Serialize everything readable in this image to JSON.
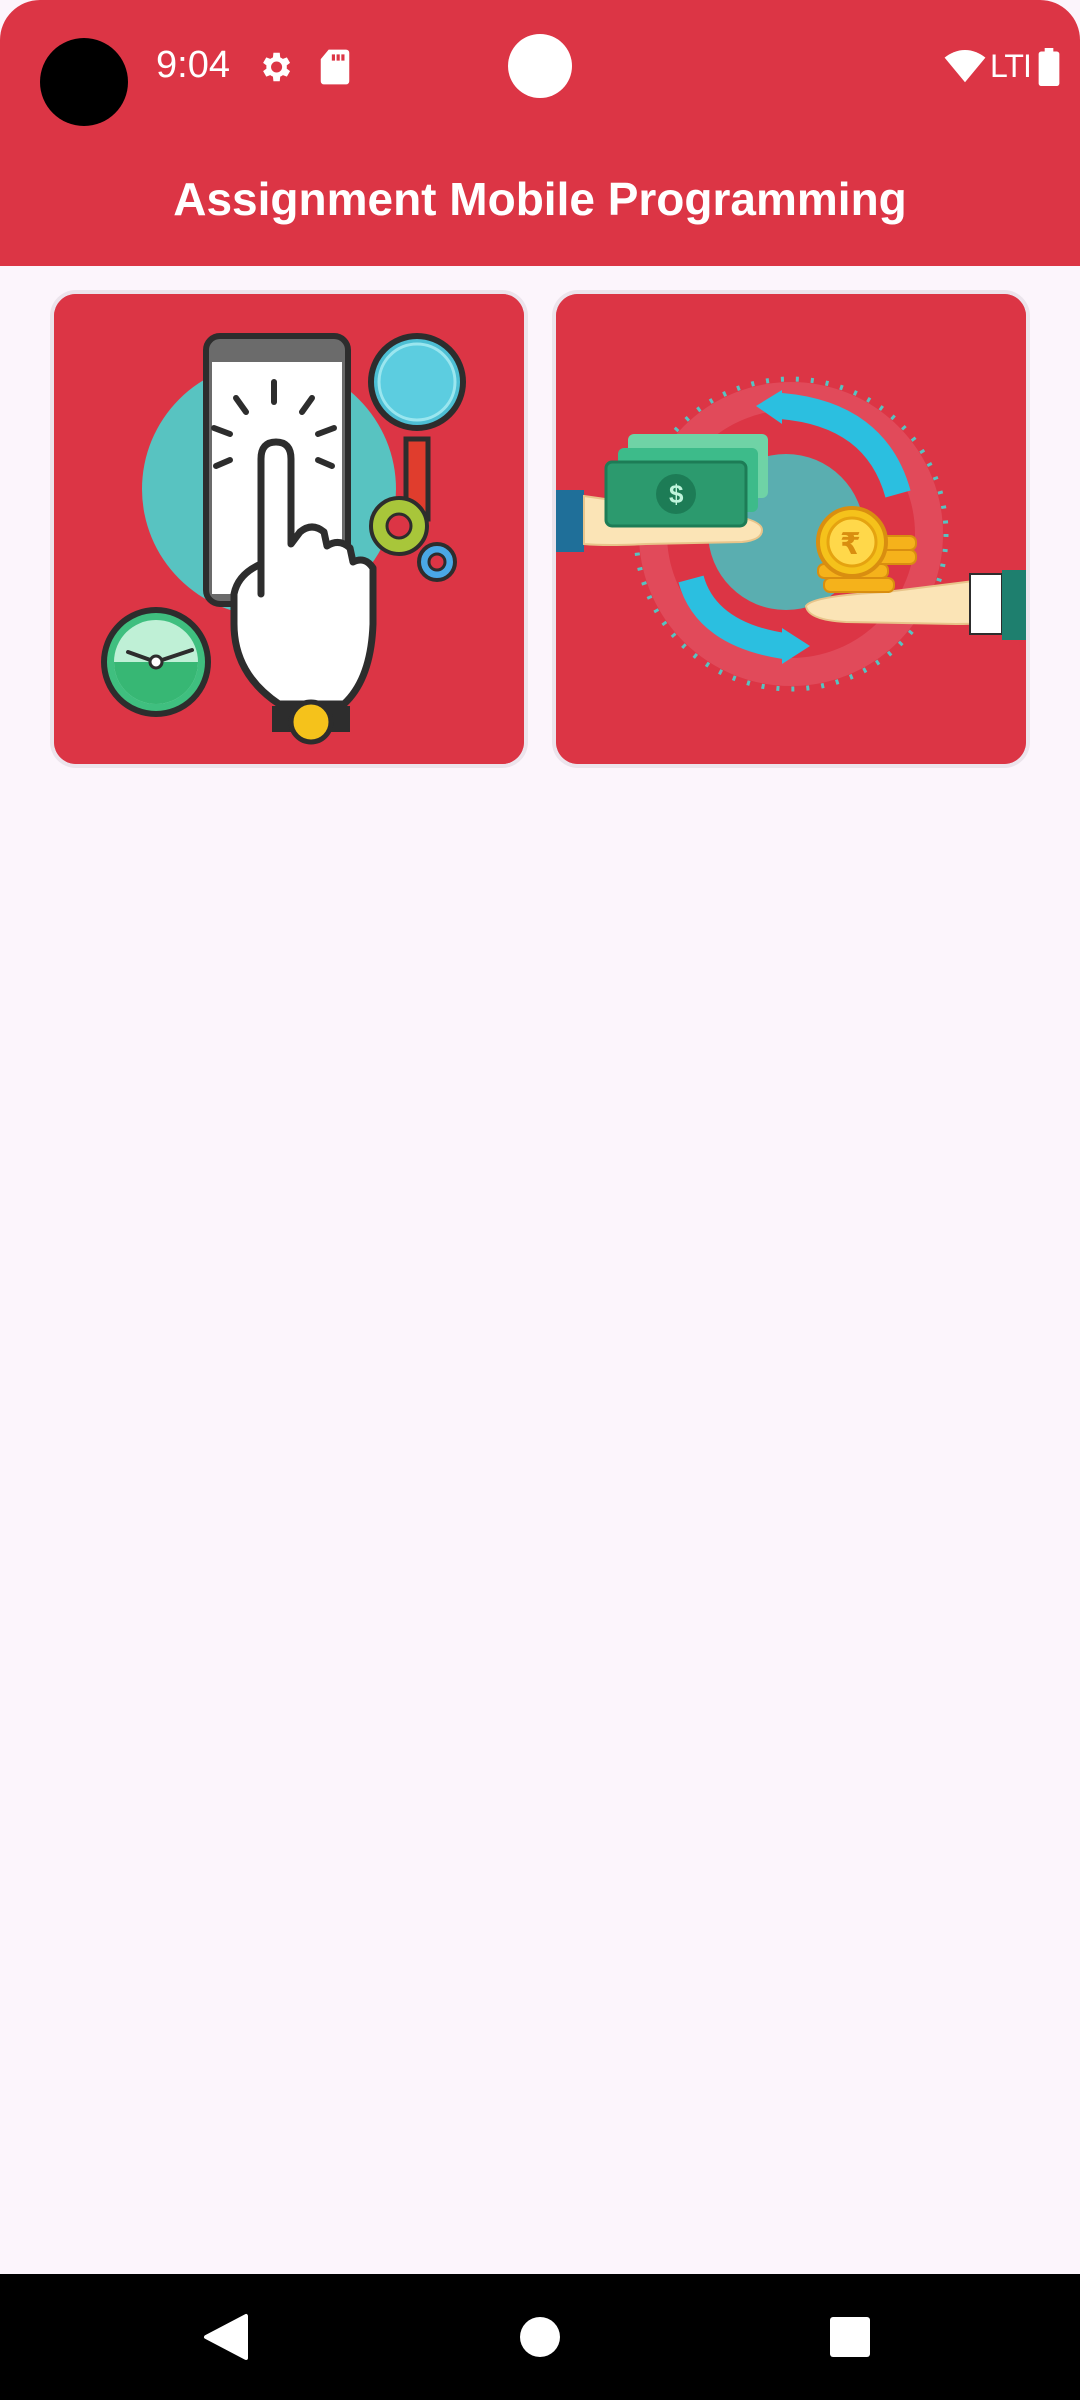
{
  "status_bar": {
    "time": "9:04",
    "network": "LTI",
    "icons": [
      "settings-icon",
      "sd-card-icon",
      "wifi-icon",
      "battery-icon"
    ]
  },
  "app_bar": {
    "title": "Assignment Mobile Programming",
    "color": "#dc3545"
  },
  "menu_cards": [
    {
      "id": "touch-tap",
      "image": "hand-tapping-smartphone-illustration"
    },
    {
      "id": "money-exchange",
      "image": "money-exchange-hands-illustration"
    }
  ],
  "navigation": {
    "buttons": [
      "back-icon",
      "home-icon",
      "recents-icon"
    ]
  },
  "colors": {
    "primary": "#dc3545",
    "background": "#fcf5fc",
    "teal": "#58c3c1",
    "cyan": "#2bbfe0",
    "gold": "#f5c21b",
    "money_green": "#2c9a6e"
  }
}
